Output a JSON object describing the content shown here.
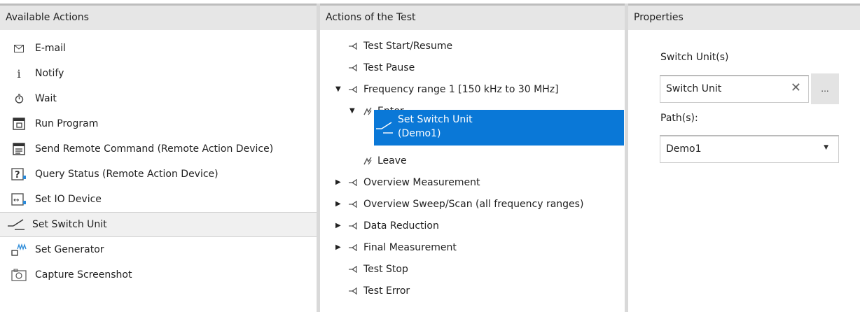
{
  "available_actions": {
    "header": "Available Actions",
    "items": [
      {
        "label": "E-mail",
        "icon": "mail-icon"
      },
      {
        "label": "Notify",
        "icon": "info-icon"
      },
      {
        "label": "Wait",
        "icon": "timer-icon"
      },
      {
        "label": "Run Program",
        "icon": "run-program-icon"
      },
      {
        "label": "Send Remote Command (Remote Action Device)",
        "icon": "remote-command-icon"
      },
      {
        "label": "Query Status (Remote Action Device)",
        "icon": "query-status-icon"
      },
      {
        "label": "Set IO Device",
        "icon": "io-device-icon"
      },
      {
        "label": "Set Switch Unit",
        "icon": "switch-unit-icon",
        "selected": true
      },
      {
        "label": "Set Generator",
        "icon": "generator-icon"
      },
      {
        "label": "Capture Screenshot",
        "icon": "camera-icon"
      }
    ]
  },
  "test_actions": {
    "header": "Actions of the Test",
    "nodes": [
      {
        "label": "Test Start/Resume",
        "expander": "none"
      },
      {
        "label": "Test Pause",
        "expander": "none"
      },
      {
        "label": "Frequency range 1 [150 kHz to 30 MHz]",
        "expander": "expanded"
      },
      {
        "label": "Enter",
        "expander": "expanded"
      },
      {
        "label": "Set Switch Unit",
        "label2": "(Demo1)",
        "selected": true
      },
      {
        "label": "Leave",
        "expander": "none"
      },
      {
        "label": "Overview Measurement",
        "expander": "collapsed"
      },
      {
        "label": "Overview Sweep/Scan (all frequency ranges)",
        "expander": "collapsed"
      },
      {
        "label": "Data Reduction",
        "expander": "collapsed"
      },
      {
        "label": "Final Measurement",
        "expander": "collapsed"
      },
      {
        "label": "Test Stop",
        "expander": "none"
      },
      {
        "label": "Test Error",
        "expander": "none"
      }
    ]
  },
  "properties": {
    "header": "Properties",
    "switch_units_label": "Switch Unit(s)",
    "switch_unit_value": "Switch Unit",
    "clear_glyph": "✕",
    "ellipsis_label": "...",
    "paths_label": "Path(s):",
    "path_value": "Demo1"
  },
  "colors": {
    "selection": "#0a78d7",
    "header_bg": "#e6e6e6"
  }
}
